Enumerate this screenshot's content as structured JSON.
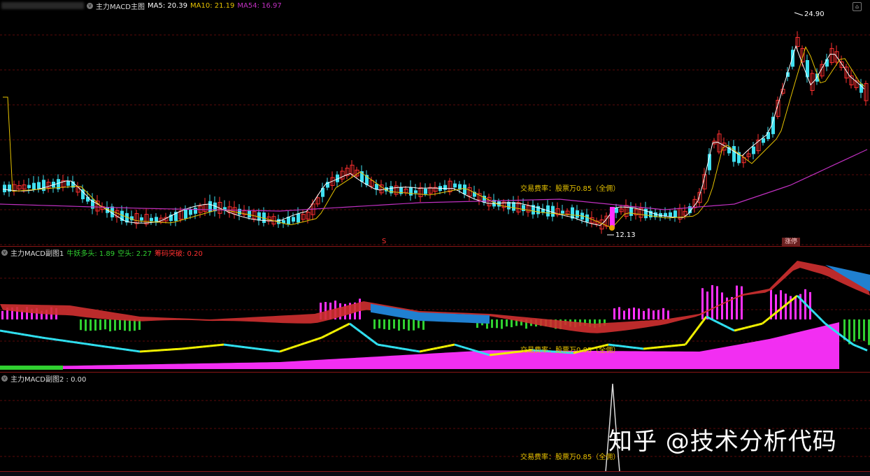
{
  "main_panel": {
    "title": "主力MACD主图",
    "ma_items": [
      {
        "label": "MA5: 20.39",
        "color": "#ffffff"
      },
      {
        "label": "MA10: 21.19",
        "color": "#e6c200"
      },
      {
        "label": "MA54: 16.97",
        "color": "#c030c0"
      }
    ],
    "high_label": "24.90",
    "low_label": "12.13",
    "note": "交易费率：股票万0.85（全佣）",
    "limit_up_badge": "涨停",
    "s_mark": "S",
    "corner_icon": "⌂"
  },
  "sub_panel_1": {
    "title": "主力MACD副图1",
    "items": [
      {
        "label": "牛妖多头: 1.89",
        "color": "#30d030"
      },
      {
        "label": "空头: 2.27",
        "color": "#30d030"
      },
      {
        "label": "筹码突破: 0.20",
        "color": "#ff3030"
      }
    ],
    "note": "交易费率：股票万0.85（全佣）"
  },
  "sub_panel_2": {
    "title": "主力MACD副图2 : 0.00",
    "note": "交易费率：股票万0.85（全佣）"
  },
  "watermark": "知乎 @技术分析代码",
  "colors": {
    "up": "#ff3030",
    "down": "#40e0f0",
    "ma5": "#ffffff",
    "ma10": "#e6c200",
    "ma54": "#c030c0",
    "grid": "#5a0a0a",
    "pink": "#ff30ff",
    "green": "#30d030",
    "cyan": "#30e0f0",
    "yellow": "#f0f000",
    "red_fill": "#d03030",
    "blue_fill": "#2080d0"
  }
}
